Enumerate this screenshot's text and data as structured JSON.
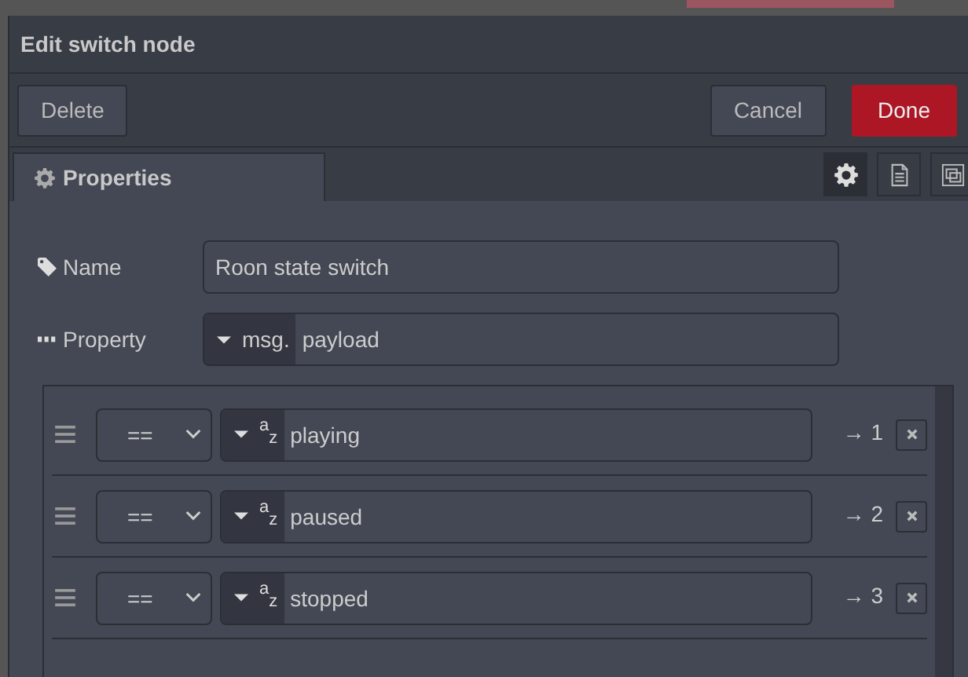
{
  "window": {
    "title": "Edit switch node"
  },
  "buttons": [
    {
      "label": "Delete",
      "kind": "plain"
    },
    {
      "label": "Cancel",
      "kind": "plain"
    },
    {
      "label": "Done",
      "kind": "primary"
    }
  ],
  "tabs": [
    {
      "label": "Properties",
      "selected": true
    }
  ],
  "tool_tabs": [
    {
      "kind": "gear",
      "selected": true
    },
    {
      "kind": "document",
      "selected": false
    },
    {
      "kind": "frame",
      "selected": false
    }
  ],
  "fields": [
    {
      "label": "Name",
      "kind": "text",
      "value": "Roon state switch"
    },
    {
      "label": "Property",
      "kind": "typed",
      "prefix": "msg.",
      "value": "payload"
    }
  ],
  "rules": [
    {
      "operator": "==",
      "type_label": "$^{a}$$_{z}$",
      "value": "playing",
      "output": "→ 1"
    },
    {
      "operator": "==",
      "type_label": "$^{a}$$_{z}$",
      "value": "paused",
      "output": "→ 2"
    },
    {
      "operator": "==",
      "type_label": "$^{a}$$_{z}$",
      "value": "stopped",
      "output": "→ 3"
    }
  ]
}
